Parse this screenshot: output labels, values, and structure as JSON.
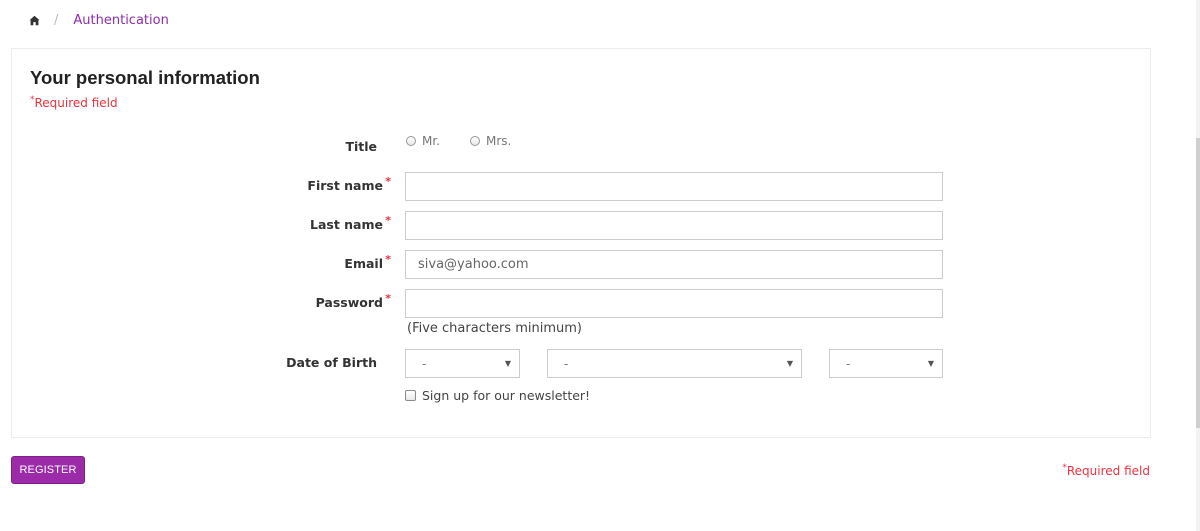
{
  "breadcrumb": {
    "home_icon": "home-icon",
    "separator": "/",
    "current": "Authentication"
  },
  "form": {
    "section_title": "Your personal information",
    "required_star": "*",
    "required_note": "Required field",
    "title_label": "Title",
    "title_options": [
      "Mr.",
      "Mrs."
    ],
    "first_name_label": "First name",
    "first_name_value": "",
    "last_name_label": "Last name",
    "last_name_value": "",
    "email_label": "Email",
    "email_value": "siva@yahoo.com",
    "password_label": "Password",
    "password_value": "",
    "password_hint": "(Five characters minimum)",
    "dob_label": "Date of Birth",
    "dob_day": "-",
    "dob_month": "-",
    "dob_year": "-",
    "newsletter_label": "Sign up for our newsletter!"
  },
  "actions": {
    "register_label": "REGISTER"
  },
  "colors": {
    "accent": "#9b2ba8",
    "required": "#e8333f",
    "breadcrumb_link": "#8c2fa8"
  }
}
